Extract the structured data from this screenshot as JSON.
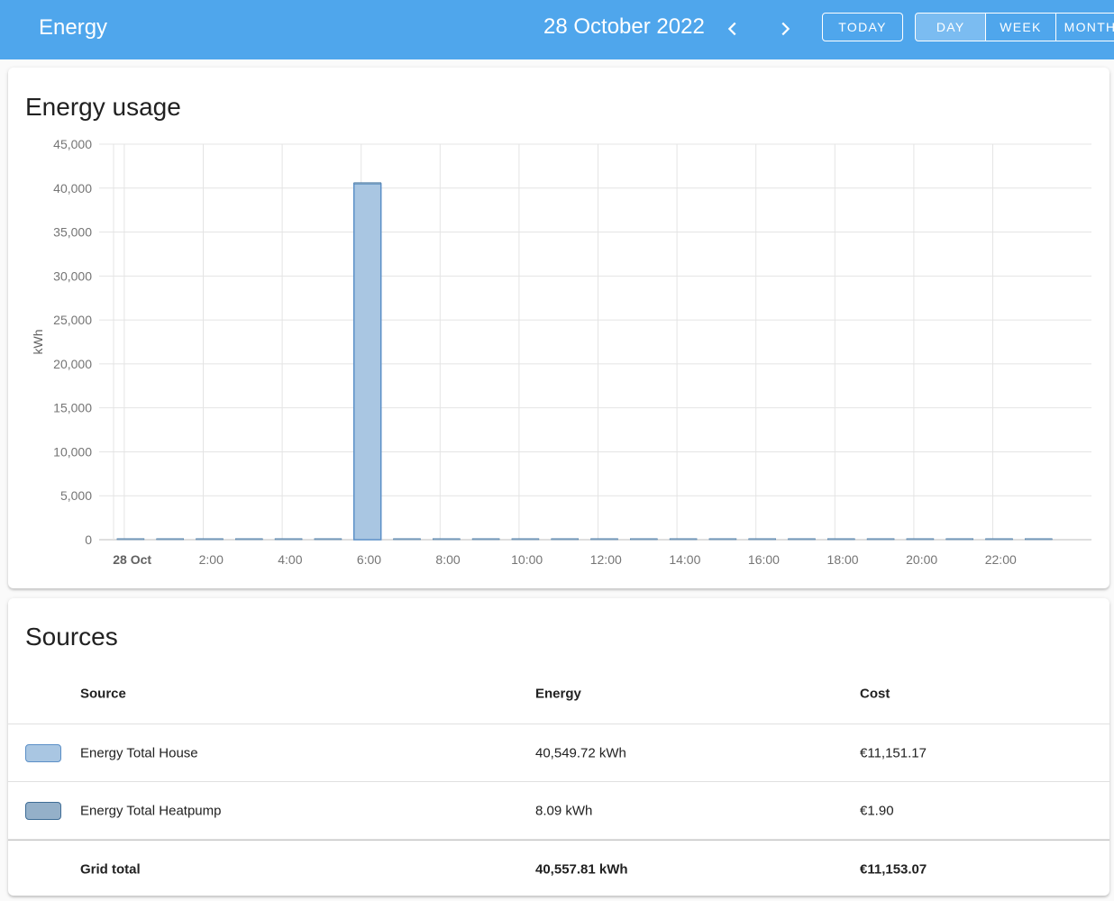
{
  "header": {
    "title": "Energy",
    "date": "28 October 2022",
    "today_label": "TODAY",
    "periods": [
      {
        "label": "DAY",
        "active": true
      },
      {
        "label": "WEEK",
        "active": false
      },
      {
        "label": "MONTH",
        "active": false
      }
    ],
    "prev_icon": "chevron-left-icon",
    "next_icon": "chevron-right-icon"
  },
  "usage_card": {
    "title": "Energy usage"
  },
  "chart_data": {
    "type": "bar",
    "ylabel": "kWh",
    "ylim": [
      0,
      45000
    ],
    "yticks": [
      "45,000",
      "40,000",
      "35,000",
      "30,000",
      "25,000",
      "20,000",
      "15,000",
      "10,000",
      "5,000",
      "0"
    ],
    "xtick_labels": [
      "28 Oct",
      "2:00",
      "4:00",
      "6:00",
      "8:00",
      "10:00",
      "12:00",
      "14:00",
      "16:00",
      "18:00",
      "20:00",
      "22:00"
    ],
    "grid": true,
    "categories": [
      "0:00",
      "1:00",
      "2:00",
      "3:00",
      "4:00",
      "5:00",
      "6:00",
      "7:00",
      "8:00",
      "9:00",
      "10:00",
      "11:00",
      "12:00",
      "13:00",
      "14:00",
      "15:00",
      "16:00",
      "17:00",
      "18:00",
      "19:00",
      "20:00",
      "21:00",
      "22:00",
      "23:00"
    ],
    "series": [
      {
        "name": "Energy Total House",
        "color": "#a9c6e2",
        "stroke": "#5b8fc7",
        "values": [
          0,
          0,
          0,
          0,
          0,
          0,
          40500,
          0,
          0,
          0,
          0,
          0,
          0,
          0,
          0,
          0,
          0,
          0,
          0,
          0,
          0,
          0,
          0,
          0
        ]
      },
      {
        "name": "Energy Total Heatpump",
        "color": "#94b0c9",
        "stroke": "#4a7aa6",
        "values": [
          0.34,
          0.34,
          0.34,
          0.34,
          0.34,
          0.34,
          0.34,
          0.34,
          0.34,
          0.34,
          0.34,
          0.34,
          0.34,
          0.34,
          0.34,
          0.34,
          0.34,
          0.34,
          0.34,
          0.34,
          0.34,
          0.34,
          0.34,
          0.27
        ]
      }
    ]
  },
  "sources_card": {
    "title": "Sources",
    "columns": {
      "source": "Source",
      "energy": "Energy",
      "cost": "Cost"
    },
    "rows": [
      {
        "source": "Energy Total House",
        "energy": "40,549.72 kWh",
        "cost": "€11,151.17",
        "color": "#a9c6e2",
        "border": "#5b8fc7"
      },
      {
        "source": "Energy Total Heatpump",
        "energy": "8.09 kWh",
        "cost": "€1.90",
        "color": "#94b0c9",
        "border": "#3f6d96"
      }
    ],
    "total": {
      "label": "Grid total",
      "energy": "40,557.81 kWh",
      "cost": "€11,153.07"
    }
  }
}
